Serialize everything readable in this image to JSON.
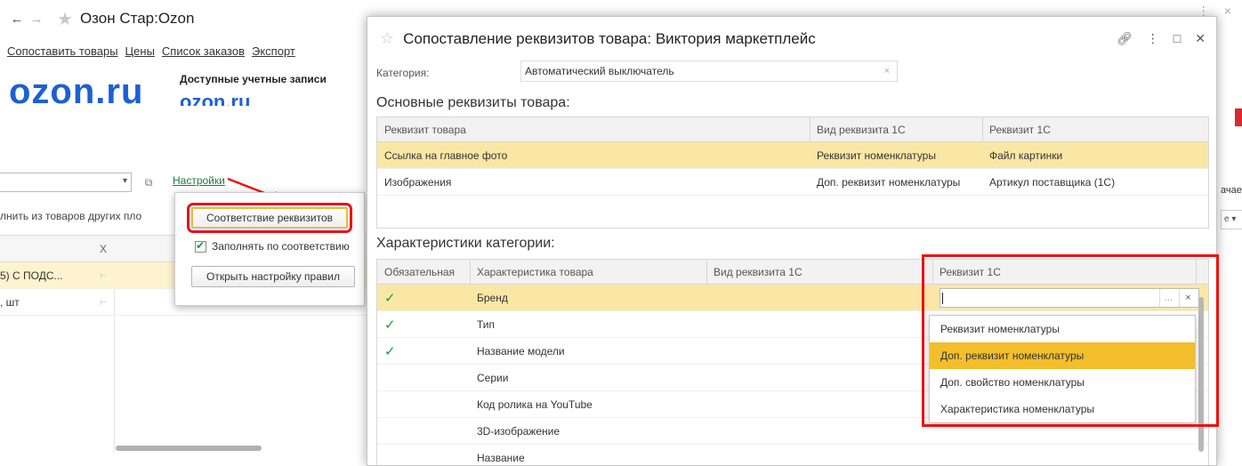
{
  "bg": {
    "title": "Озон Стар:Ozon",
    "menu": [
      "Сопоставить товары",
      "Цены",
      "Список заказов",
      "Экспорт"
    ],
    "logo_text": "ozon.ru",
    "accounts_label": "Доступные учетные записи",
    "settings_link": "Настройки",
    "fill_from_label": "лнить из товаров других пло",
    "table_header_x": "X",
    "rows": [
      {
        "text": "5) С ПОДС...",
        "selected": true
      },
      {
        "text": ", шт",
        "selected": false
      }
    ],
    "right_fragment": "ачает"
  },
  "popup": {
    "match_button": "Соответствие реквизитов",
    "fill_checkbox_label": "Заполнять по соответствию",
    "fill_checkbox_checked": true,
    "open_rules_button": "Открыть настройку правил"
  },
  "dialog": {
    "title": "Сопоставление реквизитов товара: Виктория маркетплейс",
    "category_label": "Категория:",
    "category_value": "Автоматический выключатель",
    "main_section_title": "Основные реквизиты товара:",
    "main_table": {
      "headers": [
        "Реквизит товара",
        "Вид реквизита 1С",
        "Реквизит 1С"
      ],
      "rows": [
        {
          "attr": "Ссылка на главное фото",
          "kind": "Реквизит номенклатуры",
          "value": "Файл картинки",
          "selected": true
        },
        {
          "attr": "Изображения",
          "kind": "Доп. реквизит номенклатуры",
          "value": "Артикул поставщика (1С)",
          "selected": false
        }
      ]
    },
    "char_section_title": "Характеристики категории:",
    "char_table": {
      "headers": [
        "Обязательная",
        "Характеристика товара",
        "Вид реквизита 1С",
        "Реквизит 1С"
      ],
      "rows": [
        {
          "required": true,
          "name": "Бренд"
        },
        {
          "required": true,
          "name": "Тип"
        },
        {
          "required": true,
          "name": "Название модели"
        },
        {
          "required": false,
          "name": "Серии"
        },
        {
          "required": false,
          "name": "Код ролика на YouTube"
        },
        {
          "required": false,
          "name": "3D-изображение"
        },
        {
          "required": false,
          "name": "Название"
        }
      ]
    },
    "dropdown_items": [
      "Реквизит номенклатуры",
      "Доп. реквизит номенклатуры",
      "Доп. свойство номенклатуры",
      "Характеристика номенклатуры"
    ],
    "dropdown_active_index": 1
  },
  "colors": {
    "accent_red": "#e11111",
    "selection": "#fbe7a5",
    "dropdown_active": "#f3be2c",
    "check_green": "#1a9a3a",
    "link_green": "#197a3d"
  }
}
